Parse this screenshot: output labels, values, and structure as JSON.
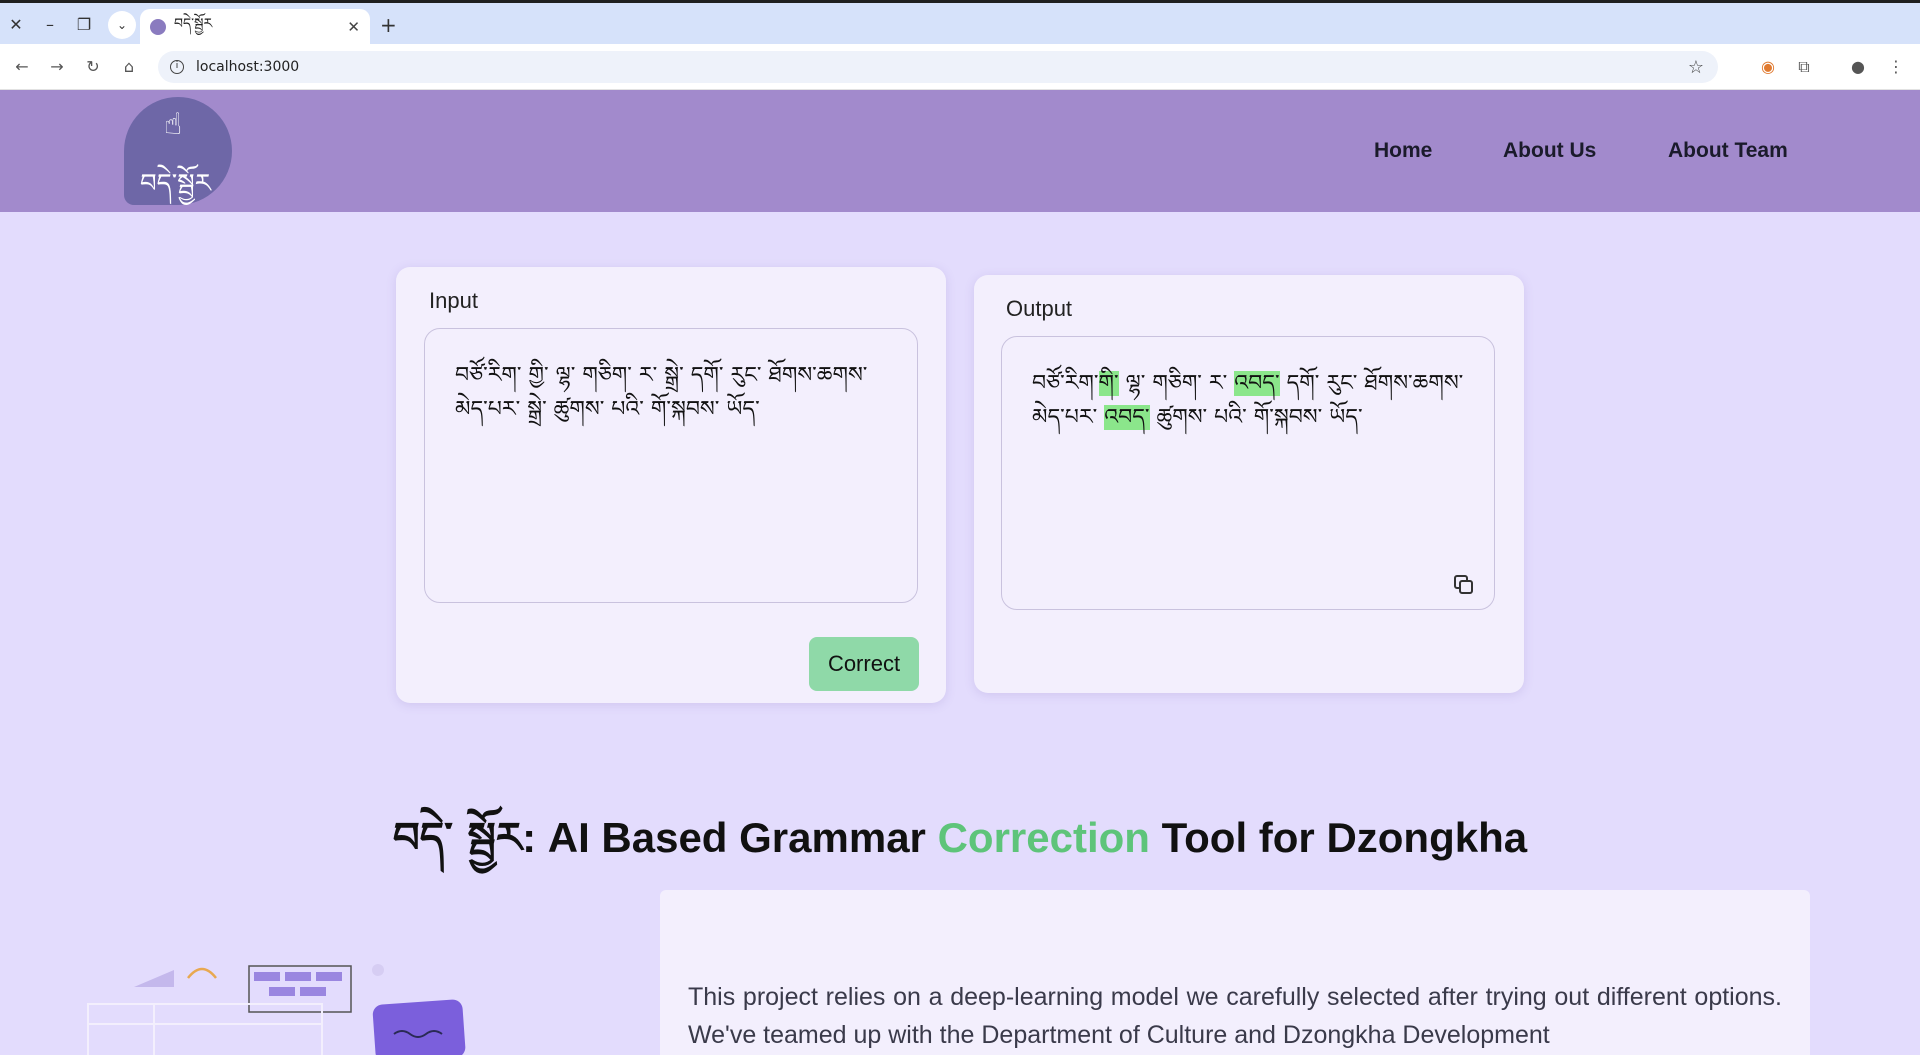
{
  "browser": {
    "tab_title": "བདེ་སྦྱོར",
    "url": "localhost:3000"
  },
  "header": {
    "logo_text": "བདེ་སྦྱོར",
    "nav": [
      {
        "label": "Home"
      },
      {
        "label": "About Us"
      },
      {
        "label": "About Team"
      }
    ]
  },
  "input_card": {
    "label": "Input",
    "text": "བཙོ་རིག་ གྱི་ ལྷ་ གཅིག་ ར་ སྒྲེ་ དགོ་ རུང་ ཐོགས་ཆགས་ མེད་པར་ སྒྲེ་ ཚུགས་ པའི་ གོ་སྐབས་ ཡོད་",
    "button_label": "Correct"
  },
  "output_card": {
    "label": "Output",
    "seg1": "བཙོ་རིག་",
    "hl1": "གི་",
    "seg2": " ལྷ་ གཅིག་ ར་",
    "hl2": "འབད་",
    "seg3": " དགོ་ རུང་ ཐོགས་ཆགས་ མེད་པར་",
    "hl3": "འབད་",
    "seg4": " ཚུགས་ པའི་ གོ་སྐབས་ ཡོད་"
  },
  "hero": {
    "dz_title": "བདེ་ སྦྱོར",
    "prefix": ": AI Based Grammar ",
    "accent": "Correction",
    "suffix": " Tool for Dzongkha",
    "accent_color": "#5ec47a"
  },
  "about": {
    "text": "This project relies on a deep-learning model we carefully selected after trying out different options. We've teamed up with the Department of Culture and Dzongkha Development"
  }
}
